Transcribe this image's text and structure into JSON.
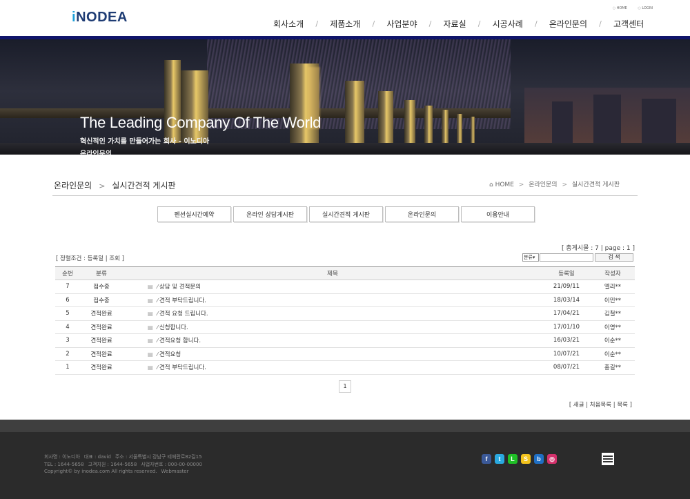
{
  "header": {
    "logo_i": "i",
    "logo_rest": "NODEA",
    "util": [
      "HOME",
      "LOGIN"
    ],
    "nav": [
      "회사소개",
      "제품소개",
      "사업분야",
      "자료실",
      "시공사례",
      "온라인문의",
      "고객센터"
    ],
    "nav_separator": "/",
    "accent_color": "#10156a"
  },
  "hero": {
    "title": "The Leading Company Of The World",
    "subtitle": "혁신적인 가치를 만들어가는 회사 - 이노디아",
    "page": "온라인문의"
  },
  "location": {
    "section": "온라인문의",
    "arrow": ">",
    "current": "실시간견적 게시판",
    "breadcrumb": [
      "HOME",
      "온라인문의",
      "실시간견적 게시판"
    ],
    "home_icon": "⌂"
  },
  "tabs": [
    "펜션실시간예약",
    "온라인 상담게시판",
    "실시간견적 게시판",
    "온라인문의",
    "이용안내"
  ],
  "board": {
    "total": "[ 총게시물 : 7 | page : 1 ]",
    "condition": "[ 정렬조건 : 등록일 | 조회 ]",
    "search_select": "분류",
    "search_button": "검 색",
    "columns": [
      "순번",
      "분류",
      "제목",
      "등록일",
      "작성자"
    ],
    "rows": [
      {
        "num": "7",
        "status": "접수중",
        "status_type": "ing",
        "title": "상담 및 견적문의",
        "date": "21/09/11",
        "writer": "엘리**"
      },
      {
        "num": "6",
        "status": "접수중",
        "status_type": "ing",
        "title": "견적 부탁드립니다.",
        "date": "18/03/14",
        "writer": "이민**"
      },
      {
        "num": "5",
        "status": "견적완료",
        "status_type": "done",
        "title": "견적 요청 드립니다.",
        "date": "17/04/21",
        "writer": "김철**"
      },
      {
        "num": "4",
        "status": "견적완료",
        "status_type": "done",
        "title": "신청합니다.",
        "date": "17/01/10",
        "writer": "이영**"
      },
      {
        "num": "3",
        "status": "견적완료",
        "status_type": "done",
        "title": "견적요청 합니다.",
        "date": "16/03/21",
        "writer": "이순**"
      },
      {
        "num": "2",
        "status": "견적완료",
        "status_type": "done",
        "title": "견적요청",
        "date": "10/07/21",
        "writer": "이순**"
      },
      {
        "num": "1",
        "status": "견적완료",
        "status_type": "done",
        "title": "견적 부탁드립니다.",
        "date": "08/07/21",
        "writer": "홍길**"
      }
    ],
    "page": "1",
    "links": "[ 새글 | 처음목록 | 목록 ]"
  },
  "footer": {
    "line1": [
      "회사명 : 이노디아",
      "대표 : david",
      "주소 : 서울특별시 강남구 테헤란로82길15"
    ],
    "line2": [
      "TEL : 1644-5658",
      "고객지원 : 1644-5658",
      "사업자번호 : 000-00-00000"
    ],
    "line3": [
      "Copyright© by inodea.com All rights reserved.",
      "Webmaster"
    ],
    "sns": [
      {
        "icon": "facebook-icon",
        "glyph": "f",
        "color": "#3b5998"
      },
      {
        "icon": "twitter-icon",
        "glyph": "t",
        "color": "#2aa9e0"
      },
      {
        "icon": "line-icon",
        "glyph": "L",
        "color": "#1fbf26"
      },
      {
        "icon": "kakaostory-icon",
        "glyph": "S",
        "color": "#f3c31d"
      },
      {
        "icon": "blog-icon",
        "glyph": "b",
        "color": "#1f6fc4"
      },
      {
        "icon": "instagram-icon",
        "glyph": "◎",
        "color": "#d4306b"
      }
    ]
  }
}
